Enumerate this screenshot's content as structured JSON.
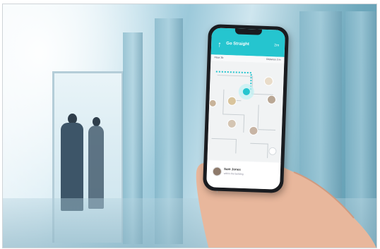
{
  "app": {
    "direction_title": "Go Straight",
    "distance": "2m",
    "sub_left": "Floor 3b",
    "sub_right": "Distance 2 m",
    "person_name": "Sam Jones",
    "person_detail": "within the building",
    "accent_color": "#25c5cf"
  },
  "icons": {
    "direction": "up-arrow-icon",
    "compass": "location-pin-icon"
  }
}
